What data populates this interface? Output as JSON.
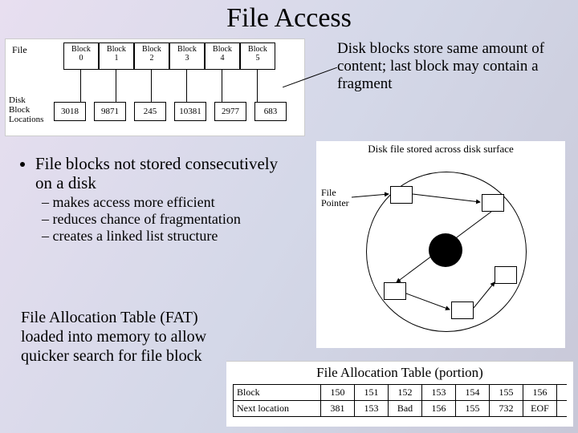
{
  "title": "File Access",
  "diagram_top": {
    "file_label": "File",
    "disk_block_locations_label": "Disk\nBlock\nLocations",
    "block_word": "Block",
    "block_ids": [
      "0",
      "1",
      "2",
      "3",
      "4",
      "5"
    ],
    "locations": [
      "3018",
      "9871",
      "245",
      "10381",
      "2977",
      "683"
    ]
  },
  "callout": "Disk blocks store same amount of content; last block may contain a fragment",
  "bullets": {
    "main": "File blocks not stored consecutively on a disk",
    "subs": [
      "makes access more efficient",
      "reduces chance of fragmentation",
      "creates a linked list structure"
    ]
  },
  "fat_text": "File Allocation Table (FAT) loaded into memory to allow quicker search for file block",
  "disk_fig": {
    "title": "Disk file stored across disk surface",
    "file_pointer_label": "File\nPointer"
  },
  "fat_table": {
    "title": "File Allocation Table (portion)",
    "row1_label": "Block",
    "row2_label": "Next location",
    "blocks": [
      "150",
      "151",
      "152",
      "153",
      "154",
      "155",
      "156"
    ],
    "next": [
      "381",
      "153",
      "Bad",
      "156",
      "155",
      "732",
      "EOF"
    ]
  },
  "chart_data": [
    {
      "type": "table",
      "title": "File block to disk block location mapping",
      "columns": [
        "Block",
        "Disk Block Location"
      ],
      "rows": [
        [
          "0",
          "3018"
        ],
        [
          "1",
          "9871"
        ],
        [
          "2",
          "245"
        ],
        [
          "3",
          "10381"
        ],
        [
          "4",
          "2977"
        ],
        [
          "5",
          "683"
        ]
      ]
    },
    {
      "type": "table",
      "title": "File Allocation Table (portion)",
      "columns": [
        "Block",
        "Next location"
      ],
      "rows": [
        [
          "150",
          "381"
        ],
        [
          "151",
          "153"
        ],
        [
          "152",
          "Bad"
        ],
        [
          "153",
          "156"
        ],
        [
          "154",
          "155"
        ],
        [
          "155",
          "732"
        ],
        [
          "156",
          "EOF"
        ]
      ]
    }
  ]
}
